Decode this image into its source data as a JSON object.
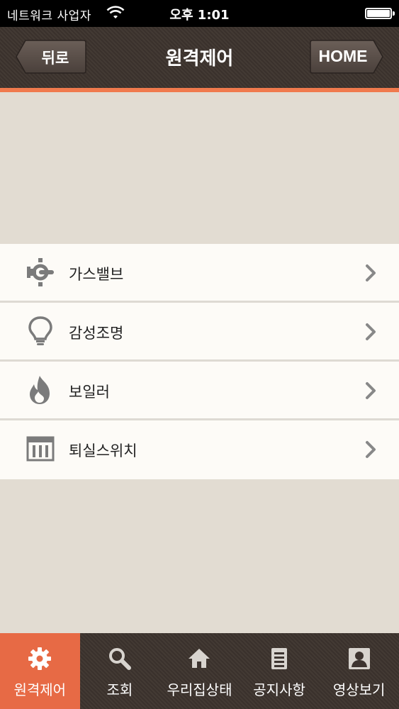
{
  "status_bar": {
    "carrier": "네트워크 사업자",
    "time": "오후 1:01"
  },
  "nav": {
    "back_label": "뒤로",
    "title": "원격제어",
    "home_label": "HOME"
  },
  "menu": [
    {
      "label": "가스밸브",
      "icon": "gas-valve-icon"
    },
    {
      "label": "감성조명",
      "icon": "lightbulb-icon"
    },
    {
      "label": "보일러",
      "icon": "flame-icon"
    },
    {
      "label": "퇴실스위치",
      "icon": "switch-panel-icon"
    }
  ],
  "tabs": [
    {
      "label": "원격제어",
      "icon": "gear-icon",
      "active": true
    },
    {
      "label": "조회",
      "icon": "search-icon",
      "active": false
    },
    {
      "label": "우리집상태",
      "icon": "home-icon",
      "active": false
    },
    {
      "label": "공지사항",
      "icon": "document-icon",
      "active": false
    },
    {
      "label": "영상보기",
      "icon": "person-icon",
      "active": false
    }
  ],
  "colors": {
    "accent": "#e76a45",
    "navbar": "#3d3430",
    "content_bg": "#e2dcd2",
    "row_bg": "#fdfbf7",
    "icon": "#7b7b7b"
  }
}
